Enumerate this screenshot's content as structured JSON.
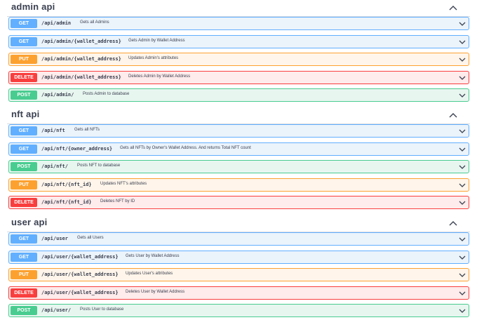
{
  "sections": [
    {
      "title": "admin api",
      "ops": [
        {
          "method": "GET",
          "kind": "get",
          "path": "/api/admin",
          "desc": "Gets all Admins"
        },
        {
          "method": "GET",
          "kind": "get",
          "path": "/api/admin/{wallet_address}",
          "desc": "Gets Admin by Wallet Address"
        },
        {
          "method": "PUT",
          "kind": "put",
          "path": "/api/admin/{wallet_address}",
          "desc": "Updates Admin's attributes"
        },
        {
          "method": "DELETE",
          "kind": "delete",
          "path": "/api/admin/{wallet_address}",
          "desc": "Deletes Admin by Wallet Address"
        },
        {
          "method": "POST",
          "kind": "post",
          "path": "/api/admin/",
          "desc": "Posts Admin to database"
        }
      ]
    },
    {
      "title": "nft api",
      "ops": [
        {
          "method": "GET",
          "kind": "get",
          "path": "/api/nft",
          "desc": "Gets all NFTs"
        },
        {
          "method": "GET",
          "kind": "get",
          "path": "/api/nft/{owner_address}",
          "desc": "Gets all NFTs by Owner's Wallet Address. And returns Total NFT count"
        },
        {
          "method": "POST",
          "kind": "post",
          "path": "/api/nft/",
          "desc": "Posts NFT to database"
        },
        {
          "method": "PUT",
          "kind": "put",
          "path": "/api/nft/{nft_id}",
          "desc": "Updates NFT's attributes"
        },
        {
          "method": "DELETE",
          "kind": "delete",
          "path": "/api/nft/{nft_id}",
          "desc": "Deletes NFT by ID"
        }
      ]
    },
    {
      "title": "user api",
      "ops": [
        {
          "method": "GET",
          "kind": "get",
          "path": "/api/user",
          "desc": "Gets all Users"
        },
        {
          "method": "GET",
          "kind": "get",
          "path": "/api/user/{wallet_address}",
          "desc": "Gets User by Wallet Address"
        },
        {
          "method": "PUT",
          "kind": "put",
          "path": "/api/user/{wallet_address}",
          "desc": "Updates User's attributes"
        },
        {
          "method": "DELETE",
          "kind": "delete",
          "path": "/api/user/{wallet_address}",
          "desc": "Deletes User by Wallet Address"
        },
        {
          "method": "POST",
          "kind": "post",
          "path": "/api/user/",
          "desc": "Posts User to database"
        }
      ]
    }
  ],
  "icons": {
    "section_toggle": "chevron-up-icon",
    "op_toggle": "chevron-down-icon"
  },
  "colors": {
    "get": "#61affe",
    "put": "#fca130",
    "delete": "#f93e3e",
    "post": "#49cc90"
  }
}
